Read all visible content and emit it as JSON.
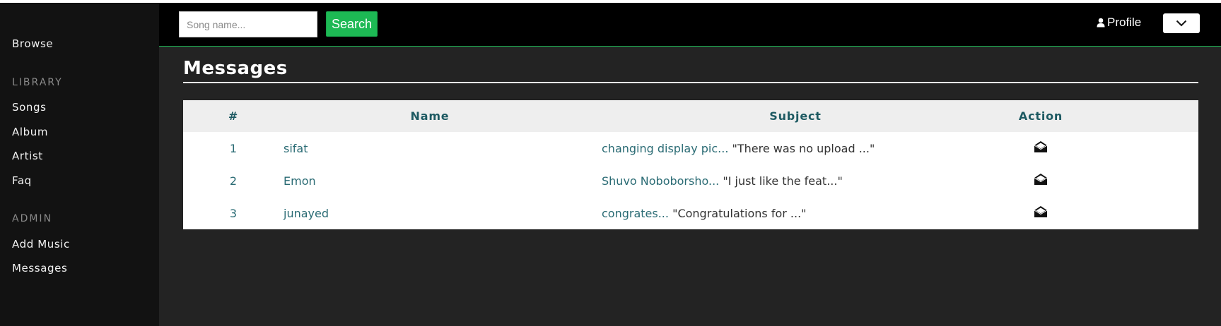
{
  "sidebar": {
    "browse": "Browse",
    "library_heading": "LIBRARY",
    "library_items": [
      "Songs",
      "Album",
      "Artist",
      "Faq"
    ],
    "admin_heading": "ADMIN",
    "admin_items": [
      "Add Music",
      "Messages"
    ]
  },
  "topbar": {
    "search_placeholder": "Song name...",
    "search_label": "Search",
    "profile_label": "Profile",
    "profile_icon": "user-icon",
    "dropdown_icon": "chevron-down-icon"
  },
  "main": {
    "title": "Messages",
    "table": {
      "columns": [
        "#",
        "Name",
        "Subject",
        "Action"
      ],
      "rows": [
        {
          "num": "1",
          "name": "sifat",
          "subject": "changing display pic...",
          "preview": "\"There was no upload ...\"",
          "action_icon": "envelope-open-icon"
        },
        {
          "num": "2",
          "name": "Emon",
          "subject": "Shuvo Noboborsho...",
          "preview": "\"I just like the feat...\"",
          "action_icon": "envelope-open-icon"
        },
        {
          "num": "3",
          "name": "junayed",
          "subject": "congrates...",
          "preview": "\"Congratulations for ...\"",
          "action_icon": "envelope-open-icon"
        }
      ]
    }
  },
  "colors": {
    "accent": "#1db954",
    "sidebar_bg": "#121212",
    "main_bg": "#232323",
    "topbar_bg": "#000000",
    "table_text": "#2a6b74"
  }
}
